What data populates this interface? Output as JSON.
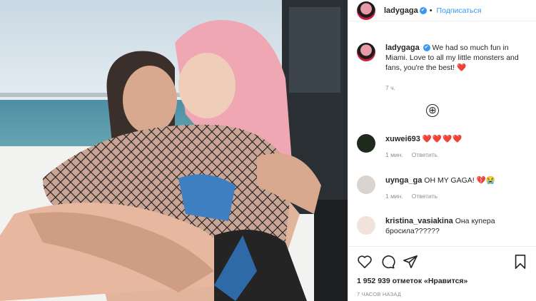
{
  "header": {
    "username": "ladygaga",
    "verified_mark": "✔",
    "follow_label": "Подписаться",
    "more_label": "•••"
  },
  "caption": {
    "username": "ladygaga",
    "text": "We had so much fun in Miami. Love to all my little monsters and fans, you're the best! ❤️",
    "time": "7 ч."
  },
  "load_more": "⊕",
  "comments": [
    {
      "username": "xuwei693",
      "text": "❤️❤️❤️❤️",
      "time": "1 мин.",
      "reply": "Ответить"
    },
    {
      "username": "uynga_ga",
      "text": "OH MY GAGA! 💔😭",
      "time": "1 мин.",
      "reply": "Ответить"
    },
    {
      "username": "kristina_vasiakina",
      "text": "Она купера бросила??????",
      "time": "",
      "reply": ""
    }
  ],
  "actions": {
    "likes_count": "1 952 939",
    "likes_text": "отметок «Нравится»",
    "posted_ago": "7 ЧАСОВ НАЗАД"
  },
  "colors": {
    "accent": "#3897f0",
    "heart": "#d0021b",
    "text": "#262626",
    "muted": "#8e8e8e"
  },
  "icons": [
    "heart-icon",
    "comment-icon",
    "share-icon",
    "bookmark-icon",
    "verified-badge-icon",
    "plus-circle-icon"
  ]
}
